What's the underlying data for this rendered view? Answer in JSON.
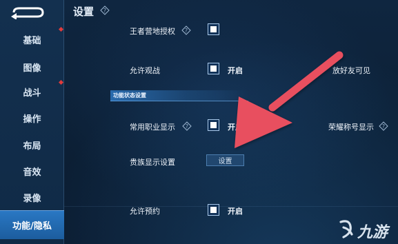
{
  "header": {
    "title": "设置"
  },
  "sidebar": {
    "items": [
      {
        "label": "基础",
        "badge": true
      },
      {
        "label": "图像",
        "badge": false
      },
      {
        "label": "战斗",
        "badge": true
      },
      {
        "label": "操作",
        "badge": false
      },
      {
        "label": "布局",
        "badge": false
      },
      {
        "label": "音效",
        "badge": false
      },
      {
        "label": "录像",
        "badge": false
      },
      {
        "label": "功能/隐私",
        "badge": false,
        "active": true
      }
    ]
  },
  "settings": {
    "camp_auth_label": "王者营地授权",
    "allow_spectate_label": "允许观战",
    "allow_spectate_state": "开启",
    "friends_visible_label": "放好友可见",
    "section_title": "功能状态设置",
    "common_job_label": "常用职业显示",
    "common_job_state": "开启",
    "honor_title_label": "荣耀称号显示",
    "noble_display_label": "贵族显示设置",
    "noble_display_button": "设置",
    "allow_reserve_label": "允许预约",
    "allow_reserve_state": "开启"
  },
  "watermark": {
    "text": "九游"
  },
  "colors": {
    "accent": "#2a78c4",
    "arrow": "#e8505e",
    "badge": "#e03b3b"
  }
}
